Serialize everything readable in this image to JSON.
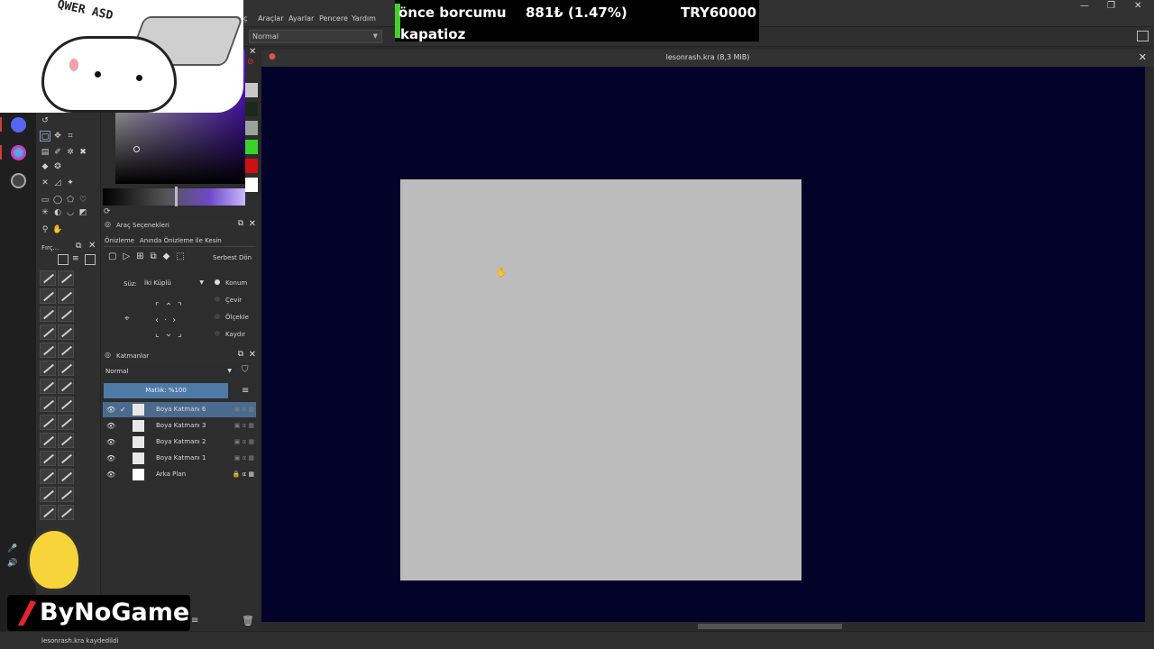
{
  "menu": {
    "items": [
      "ç",
      "Araçlar",
      "Ayarlar",
      "Pencere",
      "Yardım"
    ]
  },
  "window_controls": {
    "minimize": "—",
    "maximize": "❐",
    "close": "✕"
  },
  "toolbar": {
    "blend_mode": "Normal"
  },
  "stream_overlay": {
    "line1_left": "önce borcumu",
    "line1_mid": "881₺ (1.47%)",
    "line1_right": "TRY60000",
    "line2": "kapatioz"
  },
  "document": {
    "title": "lesonrash.kra (8,3 MiB)"
  },
  "tool_options": {
    "title": "Araç Seçenekleri",
    "tabs": [
      "Önizleme",
      "Anında Önizleme ile Kesin"
    ],
    "free_transform": "Serbest Dön",
    "filter_label": "Süz:",
    "filter_value": "İki Küplü",
    "radio_options": [
      "Konum",
      "Çevir",
      "Ölçekle",
      "Kaydır"
    ]
  },
  "brush_panel": {
    "title": "Fırç..."
  },
  "layers": {
    "title": "Katmanlar",
    "blend": "Normal",
    "opacity": "Matlık: %100",
    "rows": [
      {
        "name": "Boya Katmanı 6",
        "active": true
      },
      {
        "name": "Boya Katmanı 3",
        "active": false
      },
      {
        "name": "Boya Katmanı 2",
        "active": false
      },
      {
        "name": "Boya Katmanı 1",
        "active": false
      },
      {
        "name": "Arka Plan",
        "active": false
      }
    ]
  },
  "status": {
    "message": "lesonrash.kra kaydedildi"
  },
  "overlay_logo": {
    "text": "ByNoGame"
  },
  "sticker": {
    "keys": "QWER ASD"
  },
  "colors": {
    "canvas_bg": "#03032a",
    "doc": "#bcbcbc",
    "active_layer": "#4b6b8e",
    "accent_green": "#43d12c"
  }
}
